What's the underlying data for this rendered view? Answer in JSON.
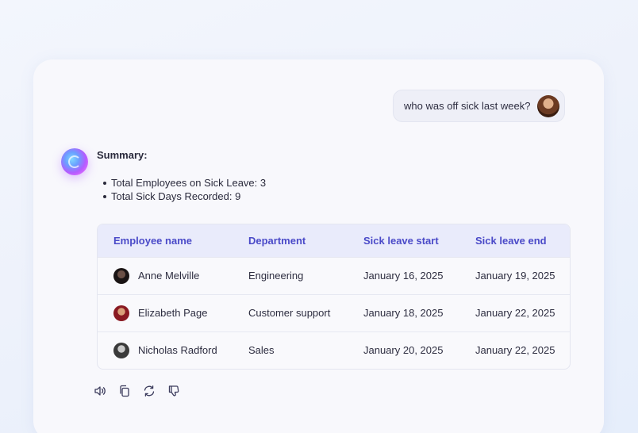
{
  "user_message": {
    "text": "who was off sick last week?"
  },
  "summary": {
    "title": "Summary:",
    "items": [
      "Total Employees on Sick Leave: 3",
      "Total Sick Days Recorded: 9"
    ]
  },
  "table": {
    "headers": [
      "Employee name",
      "Department",
      "Sick leave start",
      "Sick leave end"
    ],
    "rows": [
      {
        "name": "Anne Melville",
        "department": "Engineering",
        "start": "January 16, 2025",
        "end": "January 19, 2025"
      },
      {
        "name": "Elizabeth Page",
        "department": "Customer support",
        "start": "January 18, 2025",
        "end": "January 22, 2025"
      },
      {
        "name": "Nicholas Radford",
        "department": "Sales",
        "start": "January 20, 2025",
        "end": "January 22, 2025"
      }
    ]
  },
  "actions": {
    "icons": [
      "speaker-icon",
      "copy-icon",
      "regenerate-icon",
      "thumbs-down-icon"
    ]
  },
  "colors": {
    "header_text": "#4a4ac8",
    "header_bg": "#e9ebfb",
    "icon_stroke": "#3b3b5c"
  }
}
